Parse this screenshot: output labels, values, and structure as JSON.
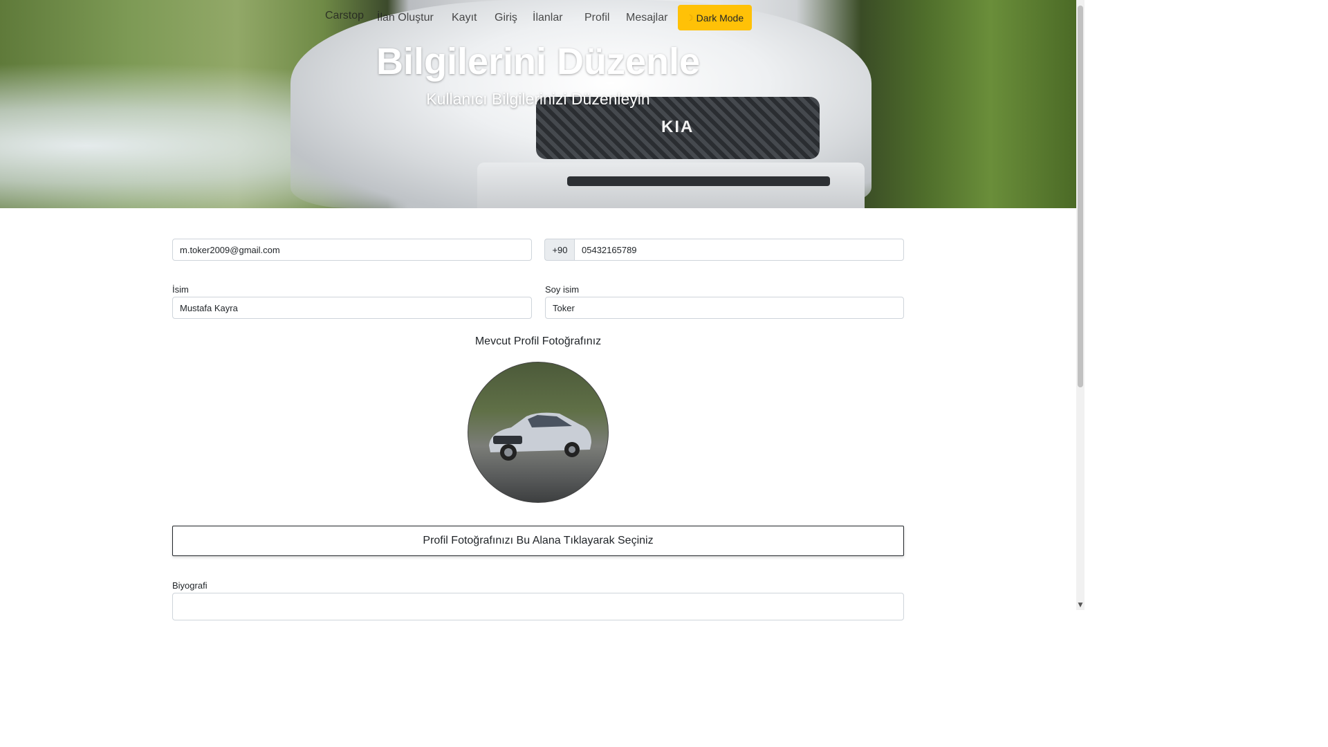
{
  "nav": {
    "links": [
      "Carstop",
      "İlan Oluştur",
      "Kayıt",
      "Giriş",
      "İlanlar",
      "Profil",
      "Mesajlar"
    ],
    "dark_mode_label": "Dark Mode",
    "dark_mode_icon": "moon-icon"
  },
  "hero": {
    "title": "Bilgilerini Düzenle",
    "subtitle": "Kullanıcı Bilgilerinizi Düzenleyin",
    "background_image": "kia-suv-photo"
  },
  "form": {
    "email_value": "m.toker2009@gmail.com",
    "phone_prefix": "+90",
    "phone_value": "05432165789",
    "first_name_label": "İsim",
    "first_name_value": "Mustafa Kayra",
    "last_name_label": "Soy isim",
    "last_name_value": "Toker",
    "current_photo_title": "Mevcut Profil Fotoğrafınız",
    "photo_image": "honda-civic-photo",
    "upload_label": "Profil Fotoğrafınızı Bu Alana Tıklayarak Seçiniz",
    "bio_label": "Biyografi",
    "bio_value": ""
  },
  "colors": {
    "accent_button": "#ffc107",
    "input_border": "#ced4da",
    "addon_bg": "#e9ecef"
  }
}
